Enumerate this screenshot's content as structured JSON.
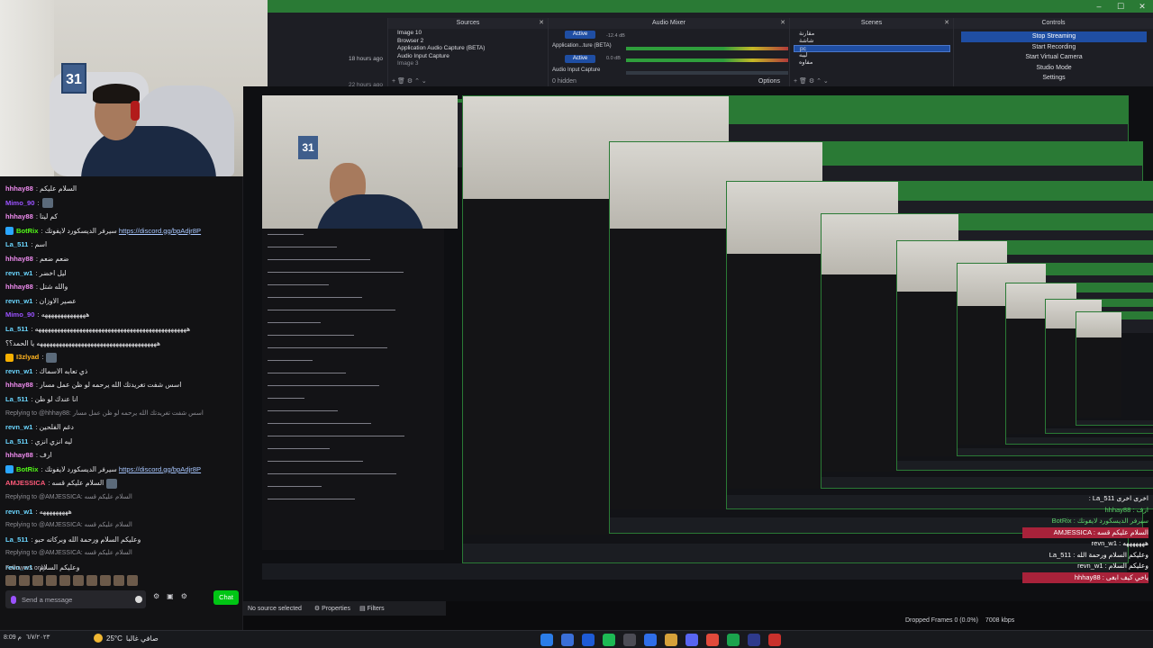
{
  "window": {
    "minimize": "–",
    "maximize": "☐",
    "close": "✕"
  },
  "webcam": {
    "sign_text": "31"
  },
  "chat": {
    "lines": [
      {
        "user": "hhhay88",
        "color": "#f08cf0",
        "text": ": السلام عليكم",
        "type": "msg"
      },
      {
        "user": "Mimo_90",
        "color": "#9b52ff",
        "text": ":",
        "type": "msg",
        "emote": true
      },
      {
        "user": "hhhay88",
        "color": "#f08cf0",
        "text": ": كم ليتا",
        "type": "msg"
      },
      {
        "user": "BotRix",
        "color": "#53fc18",
        "text": ": سيرفر الديسكورد لايفوتك ",
        "link": "https://discord.gg/bpAdjr8P",
        "type": "msg",
        "badge": "#2aa6ff"
      },
      {
        "user": "La_511",
        "color": "#6bd6ff",
        "text": ": اسم",
        "type": "msg"
      },
      {
        "user": "hhhay88",
        "color": "#f08cf0",
        "text": ": ضعم ضعم",
        "type": "msg"
      },
      {
        "user": "revn_w1",
        "color": "#6bd6ff",
        "text": ": ليل اخضر",
        "type": "msg"
      },
      {
        "user": "hhhay88",
        "color": "#f08cf0",
        "text": ": والله شتل",
        "type": "msg"
      },
      {
        "user": "revn_w1",
        "color": "#6bd6ff",
        "text": ": عصير الاوزان",
        "type": "msg"
      },
      {
        "user": "Mimo_90",
        "color": "#9b52ff",
        "text": ": ههههههههههههههه",
        "type": "msg"
      },
      {
        "user": "La_511",
        "color": "#6bd6ff",
        "text": ": ههههههههههههههههههههههههههههههههههههههههههههههههه",
        "type": "msg"
      },
      {
        "user": "",
        "color": "#e7e7ea",
        "text": "ههههههههههههههههههههههههههههههههههههههه يا الحمد؟؟",
        "type": "msg"
      },
      {
        "user": "I3zlyad",
        "color": "#ffb31f",
        "text": ":",
        "type": "msg",
        "emote": true,
        "badge": "#f7b000"
      },
      {
        "user": "revn_w1",
        "color": "#6bd6ff",
        "text": ": ذي تعابه الاسماك",
        "type": "msg"
      },
      {
        "user": "hhhay88",
        "color": "#f08cf0",
        "text": ": اسس شفت تغريدتك الله يرحمه لو ظن عمل مسار",
        "type": "msg"
      },
      {
        "user": "La_511",
        "color": "#6bd6ff",
        "text": ": انا عندك لو ظن",
        "type": "msg"
      },
      {
        "user": "",
        "color": "#8d8d94",
        "text": "Replying to @hhhay88: اسس شفت تغريدتك الله يرحمه لو ظن عمل مسار",
        "type": "reply"
      },
      {
        "user": "revn_w1",
        "color": "#6bd6ff",
        "text": ": دغم الفلحين",
        "type": "msg"
      },
      {
        "user": "La_511",
        "color": "#6bd6ff",
        "text": ": ليه انزي انزي",
        "type": "msg"
      },
      {
        "user": "hhhay88",
        "color": "#f08cf0",
        "text": ": ارف",
        "type": "msg"
      },
      {
        "user": "BotRix",
        "color": "#53fc18",
        "text": ": سيرفر الديسكورد لايفوتك ",
        "link": "https://discord.gg/bpAdjr8P",
        "type": "msg",
        "badge": "#2aa6ff"
      },
      {
        "user": "AMJESSICA",
        "color": "#ff5a7a",
        "text": ": السلام عليكم قسه",
        "type": "msg",
        "emote": true
      },
      {
        "user": "",
        "color": "#8d8d94",
        "text": "Replying to @AMJESSICA: السلام عليكم قسه",
        "type": "reply"
      },
      {
        "user": "revn_w1",
        "color": "#6bd6ff",
        "text": ": هههههههههه",
        "type": "msg"
      },
      {
        "user": "",
        "color": "#8d8d94",
        "text": "Replying to @AMJESSICA: السلام عليكم قسه",
        "type": "reply"
      },
      {
        "user": "La_511",
        "color": "#6bd6ff",
        "text": ": وعليكم السلام ورحمة الله وبركاته حبو",
        "type": "msg"
      },
      {
        "user": "",
        "color": "#8d8d94",
        "text": "Replying to @AMJESSICA: السلام عليكم قسه",
        "type": "reply"
      },
      {
        "user": "revn_w1",
        "color": "#6bd6ff",
        "text": ": وعليكم السلام",
        "type": "msg"
      }
    ],
    "followers_label": "Followers only",
    "input_placeholder": "Send a message",
    "chat_button": "Chat",
    "tool_icons": [
      "⚙",
      "▣",
      "⚙"
    ]
  },
  "obs": {
    "time_ago_1": "18 hours ago",
    "time_ago_2": "22 hours ago",
    "sources_title": "Sources",
    "sources": [
      "Image 10",
      "Browser 2",
      "Application Audio Capture (BETA)",
      "Audio Input Capture",
      "Image 3"
    ],
    "mixer_title": "Audio Mixer",
    "mixer_rows": [
      {
        "label": "Application...ture (BETA)",
        "db": "-12.4 dB",
        "state": "Active"
      },
      {
        "label": "Audio Input Capture",
        "db": "0.0 dB",
        "state": "Active"
      }
    ],
    "hidden_label": "0 hidden",
    "options_label": "Options",
    "scenes_title": "Scenes",
    "scenes": [
      "مقارنة",
      "شاشة",
      "pc",
      "ليبه",
      "مفاوه"
    ],
    "selected_scene": "pc",
    "controls_title": "Controls",
    "controls": [
      "Stop Streaming",
      "Start Recording",
      "Start Virtual Camera",
      "Studio Mode",
      "Settings"
    ],
    "no_source": "No source selected",
    "properties": "Properties",
    "filters": "Filters",
    "dropped_frames": "Dropped Frames 0 (0.0%)",
    "kbps": "7008 kbps",
    "cpu": "CPU: 4.1%, 60.00 / 60.00 FPS"
  },
  "taskbar": {
    "weather_temp": "25°C",
    "weather_desc": "صافي غالبا",
    "clock": "8:09 م",
    "date": "٦/٧/٢٠٢٣"
  },
  "overlay": {
    "lines": [
      {
        "text": ": La_511 اخرى اخرى",
        "style": ""
      },
      {
        "text": "hhhay88 : ارف",
        "style": "green"
      },
      {
        "text": "BotRix : سيرفر الديسكورد لايفوتك",
        "style": "green"
      },
      {
        "text": "AMJESSICA : السلام عليكم قسه",
        "style": "hl"
      },
      {
        "text": "revn_w1 : هههههههه",
        "style": ""
      },
      {
        "text": "La_511 : وعليكم السلام ورحمة الله",
        "style": ""
      },
      {
        "text": "revn_w1 : وعليكم السلام",
        "style": ""
      },
      {
        "text": "hhhay88 : ياخي كيف ابغى",
        "style": "hl"
      }
    ]
  }
}
